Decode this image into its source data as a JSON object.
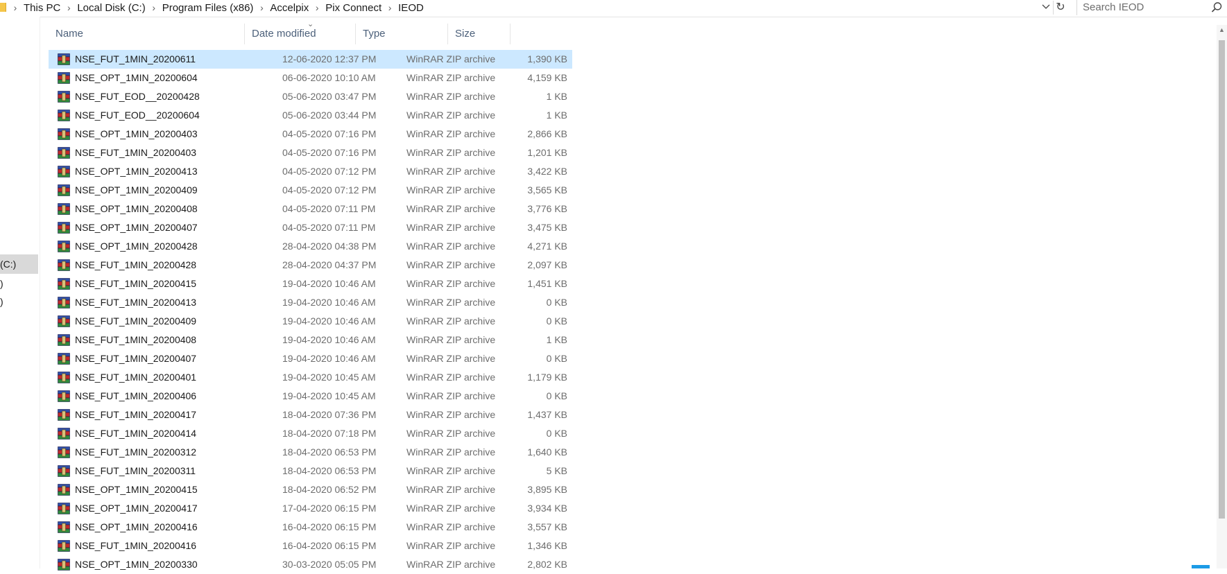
{
  "breadcrumb": [
    "This PC",
    "Local Disk (C:)",
    "Program Files (x86)",
    "Accelpix",
    "Pix Connect",
    "IEOD"
  ],
  "search": {
    "placeholder": "Search IEOD"
  },
  "nav": {
    "items": [
      "(C:)",
      ")",
      ")"
    ]
  },
  "columns": {
    "name": "Name",
    "date": "Date modified",
    "type": "Type",
    "size": "Size"
  },
  "files": [
    {
      "name": "NSE_FUT_1MIN_20200611",
      "date": "12-06-2020 12:37 PM",
      "type": "WinRAR ZIP archive",
      "size": "1,390 KB"
    },
    {
      "name": "NSE_OPT_1MIN_20200604",
      "date": "06-06-2020 10:10 AM",
      "type": "WinRAR ZIP archive",
      "size": "4,159 KB"
    },
    {
      "name": "NSE_FUT_EOD__20200428",
      "date": "05-06-2020 03:47 PM",
      "type": "WinRAR ZIP archive",
      "size": "1 KB"
    },
    {
      "name": "NSE_FUT_EOD__20200604",
      "date": "05-06-2020 03:44 PM",
      "type": "WinRAR ZIP archive",
      "size": "1 KB"
    },
    {
      "name": "NSE_OPT_1MIN_20200403",
      "date": "04-05-2020 07:16 PM",
      "type": "WinRAR ZIP archive",
      "size": "2,866 KB"
    },
    {
      "name": "NSE_FUT_1MIN_20200403",
      "date": "04-05-2020 07:16 PM",
      "type": "WinRAR ZIP archive",
      "size": "1,201 KB"
    },
    {
      "name": "NSE_OPT_1MIN_20200413",
      "date": "04-05-2020 07:12 PM",
      "type": "WinRAR ZIP archive",
      "size": "3,422 KB"
    },
    {
      "name": "NSE_OPT_1MIN_20200409",
      "date": "04-05-2020 07:12 PM",
      "type": "WinRAR ZIP archive",
      "size": "3,565 KB"
    },
    {
      "name": "NSE_OPT_1MIN_20200408",
      "date": "04-05-2020 07:11 PM",
      "type": "WinRAR ZIP archive",
      "size": "3,776 KB"
    },
    {
      "name": "NSE_OPT_1MIN_20200407",
      "date": "04-05-2020 07:11 PM",
      "type": "WinRAR ZIP archive",
      "size": "3,475 KB"
    },
    {
      "name": "NSE_OPT_1MIN_20200428",
      "date": "28-04-2020 04:38 PM",
      "type": "WinRAR ZIP archive",
      "size": "4,271 KB"
    },
    {
      "name": "NSE_FUT_1MIN_20200428",
      "date": "28-04-2020 04:37 PM",
      "type": "WinRAR ZIP archive",
      "size": "2,097 KB"
    },
    {
      "name": "NSE_FUT_1MIN_20200415",
      "date": "19-04-2020 10:46 AM",
      "type": "WinRAR ZIP archive",
      "size": "1,451 KB"
    },
    {
      "name": "NSE_FUT_1MIN_20200413",
      "date": "19-04-2020 10:46 AM",
      "type": "WinRAR ZIP archive",
      "size": "0 KB"
    },
    {
      "name": "NSE_FUT_1MIN_20200409",
      "date": "19-04-2020 10:46 AM",
      "type": "WinRAR ZIP archive",
      "size": "0 KB"
    },
    {
      "name": "NSE_FUT_1MIN_20200408",
      "date": "19-04-2020 10:46 AM",
      "type": "WinRAR ZIP archive",
      "size": "1 KB"
    },
    {
      "name": "NSE_FUT_1MIN_20200407",
      "date": "19-04-2020 10:46 AM",
      "type": "WinRAR ZIP archive",
      "size": "0 KB"
    },
    {
      "name": "NSE_FUT_1MIN_20200401",
      "date": "19-04-2020 10:45 AM",
      "type": "WinRAR ZIP archive",
      "size": "1,179 KB"
    },
    {
      "name": "NSE_FUT_1MIN_20200406",
      "date": "19-04-2020 10:45 AM",
      "type": "WinRAR ZIP archive",
      "size": "0 KB"
    },
    {
      "name": "NSE_FUT_1MIN_20200417",
      "date": "18-04-2020 07:36 PM",
      "type": "WinRAR ZIP archive",
      "size": "1,437 KB"
    },
    {
      "name": "NSE_FUT_1MIN_20200414",
      "date": "18-04-2020 07:18 PM",
      "type": "WinRAR ZIP archive",
      "size": "0 KB"
    },
    {
      "name": "NSE_FUT_1MIN_20200312",
      "date": "18-04-2020 06:53 PM",
      "type": "WinRAR ZIP archive",
      "size": "1,640 KB"
    },
    {
      "name": "NSE_FUT_1MIN_20200311",
      "date": "18-04-2020 06:53 PM",
      "type": "WinRAR ZIP archive",
      "size": "5 KB"
    },
    {
      "name": "NSE_OPT_1MIN_20200415",
      "date": "18-04-2020 06:52 PM",
      "type": "WinRAR ZIP archive",
      "size": "3,895 KB"
    },
    {
      "name": "NSE_OPT_1MIN_20200417",
      "date": "17-04-2020 06:15 PM",
      "type": "WinRAR ZIP archive",
      "size": "3,934 KB"
    },
    {
      "name": "NSE_OPT_1MIN_20200416",
      "date": "16-04-2020 06:15 PM",
      "type": "WinRAR ZIP archive",
      "size": "3,557 KB"
    },
    {
      "name": "NSE_FUT_1MIN_20200416",
      "date": "16-04-2020 06:15 PM",
      "type": "WinRAR ZIP archive",
      "size": "1,346 KB"
    },
    {
      "name": "NSE_OPT_1MIN_20200330",
      "date": "30-03-2020 05:05 PM",
      "type": "WinRAR ZIP archive",
      "size": "2,802 KB"
    }
  ],
  "icons": {
    "file": "winrar-archive-icon",
    "search": "search-icon",
    "refresh": "refresh-icon",
    "dropdown": "chevron-down-icon"
  },
  "colors": {
    "selection": "#cce8ff",
    "header_text": "#4c607a",
    "nav_selected": "#d9d9d9"
  }
}
